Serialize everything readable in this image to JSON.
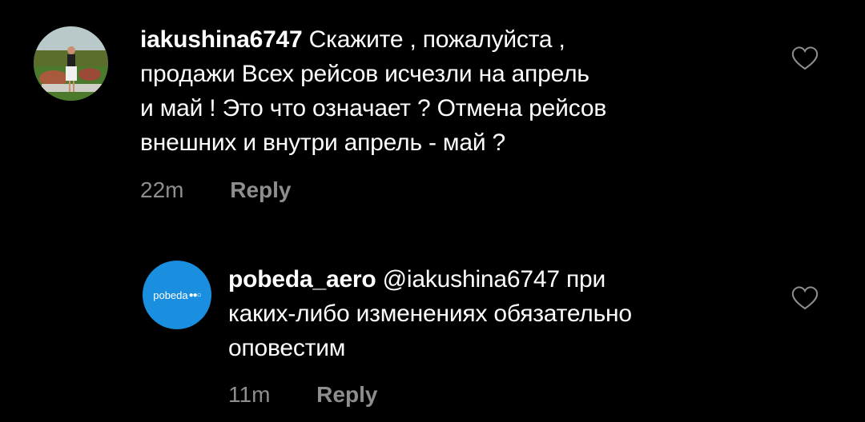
{
  "comments": [
    {
      "username": "iakushina6747",
      "text": "Скажите , пожалуйста , продажи Всех рейсов исчезли на апрель и май ! Это что означает ? Отмена рейсов внешних и внутри апрель - май ?",
      "lines": [
        "Скажите , пожалуйста ,",
        "продажи Всех рейсов исчезли на апрель",
        "и май ! Это что означает ? Отмена рейсов",
        "внешних и внутри апрель - май ?"
      ],
      "time": "22m",
      "reply_label": "Reply",
      "avatar_icon": "user-photo"
    },
    {
      "username": "pobeda_aero",
      "mention": "@iakushina6747",
      "lines_after_mention": [
        " при",
        "каких-либо изменениях обязательно",
        "оповестим"
      ],
      "time": "11m",
      "reply_label": "Reply",
      "avatar_text": "pobeda",
      "avatar_color": "#1a8fe0"
    }
  ],
  "icons": {
    "like": "heart-outline-icon"
  }
}
